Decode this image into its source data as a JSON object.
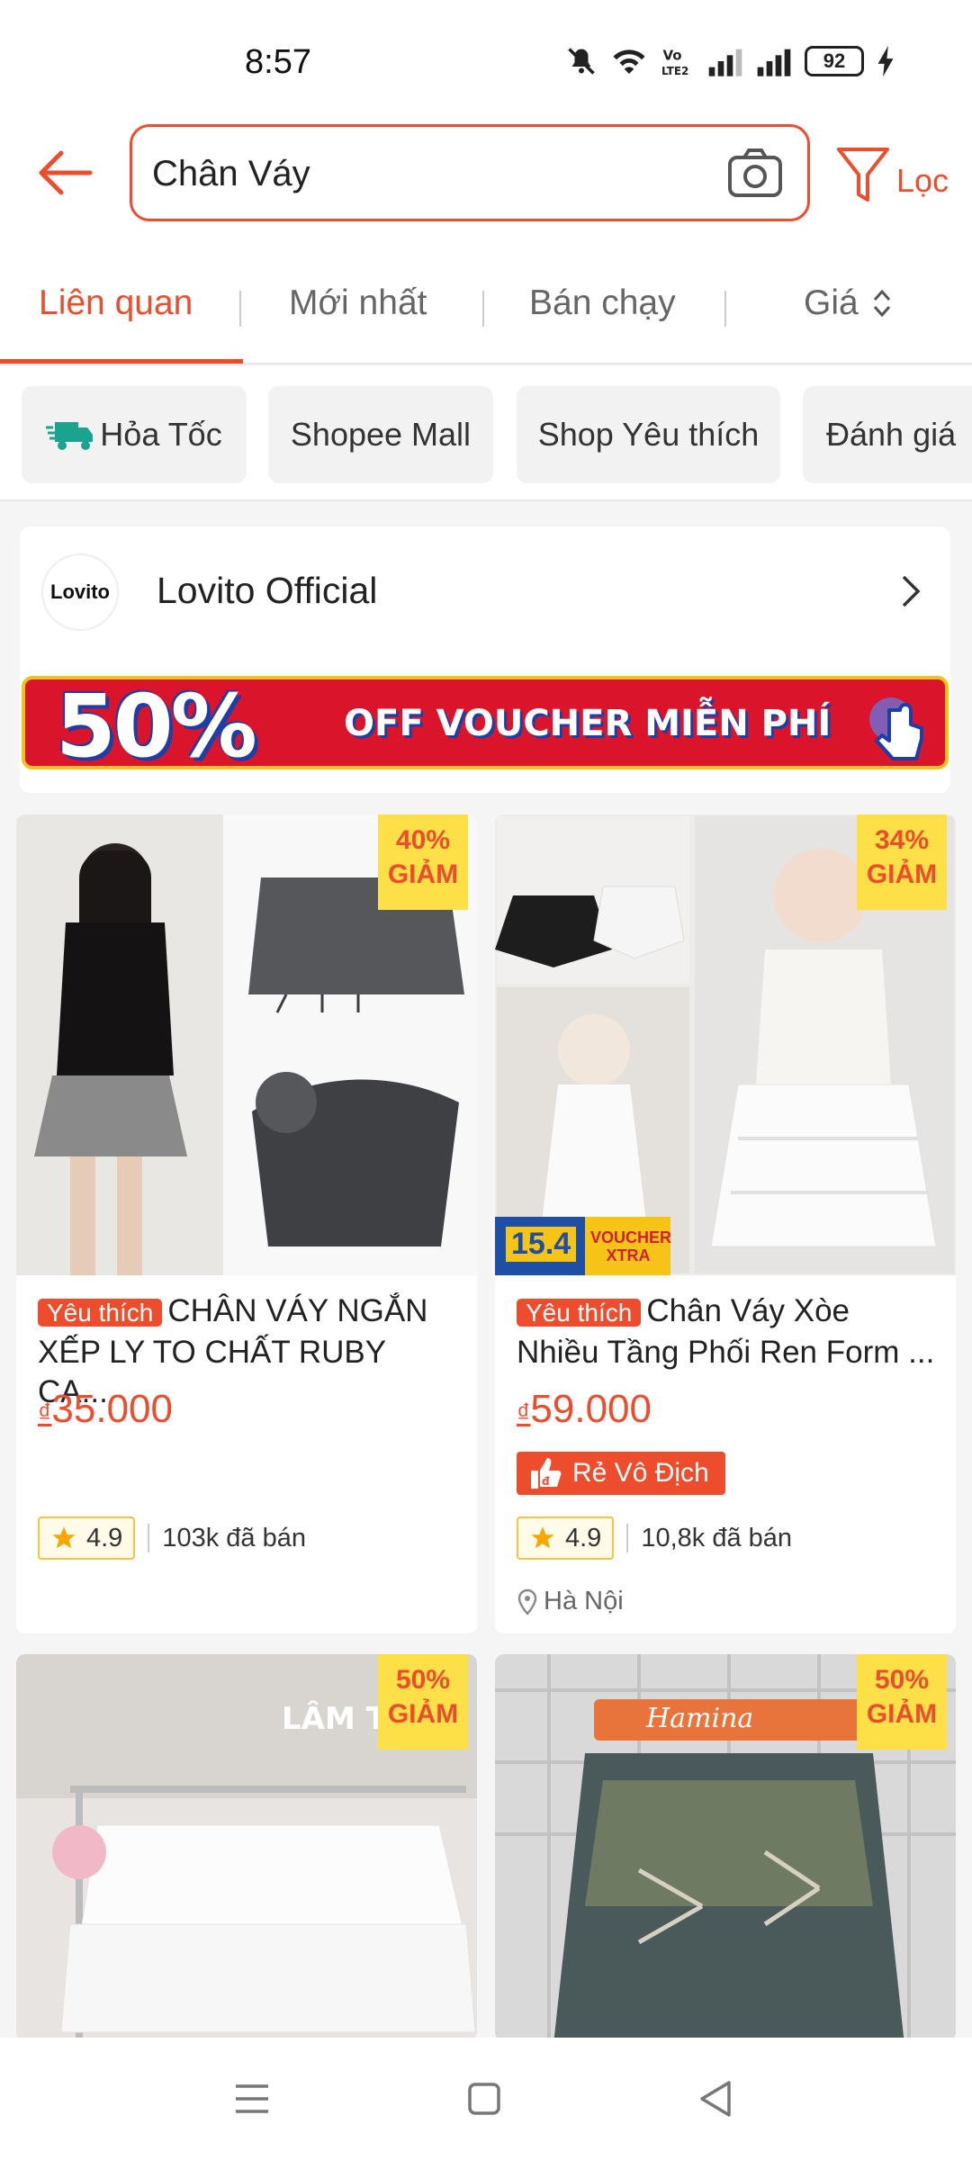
{
  "status_bar": {
    "time": "8:57",
    "battery": "92"
  },
  "search": {
    "query": "Chân Váy",
    "filter_label": "Lọc"
  },
  "sort_tabs": [
    {
      "label": "Liên quan"
    },
    {
      "label": "Mới nhất"
    },
    {
      "label": "Bán chạy"
    },
    {
      "label": "Giá"
    }
  ],
  "filter_chips": [
    {
      "label": "Hỏa Tốc"
    },
    {
      "label": "Shopee Mall"
    },
    {
      "label": "Shop Yêu thích"
    },
    {
      "label": "Đánh giá"
    }
  ],
  "shop_banner": {
    "logo_text": "Lovito",
    "name": "Lovito Official",
    "voucher_percent": "50%",
    "voucher_text": "OFF VOUCHER MIỄN PHÍ"
  },
  "products": [
    {
      "discount_pct": "40%",
      "discount_word": "GIẢM",
      "tag": "Yêu thích",
      "title": "CHÂN VÁY NGẮN XẾP LY TO CHẤT RUBY CA...",
      "currency": "₫",
      "price": "35.000",
      "rating": "4.9",
      "sold": "103k đã bán"
    },
    {
      "discount_pct": "34%",
      "discount_word": "GIẢM",
      "tag": "Yêu thích",
      "title": "Chân Váy Xòe Nhiều Tầng Phối Ren Form ...",
      "currency": "₫",
      "price": "59.000",
      "promo": "Rẻ Vô Địch",
      "voucher_date": "15.4",
      "voucher_label": "VOUCHER XTRA",
      "rating": "4.9",
      "sold": "10,8k đã bán",
      "location": "Hà Nội"
    },
    {
      "discount_pct": "50%",
      "discount_word": "GIẢM",
      "image_text": "LÂM T"
    },
    {
      "discount_pct": "50%",
      "discount_word": "GIẢM",
      "image_text": "Hamina"
    }
  ],
  "colors": {
    "accent": "#ee4d2d",
    "badge": "#fde047"
  }
}
